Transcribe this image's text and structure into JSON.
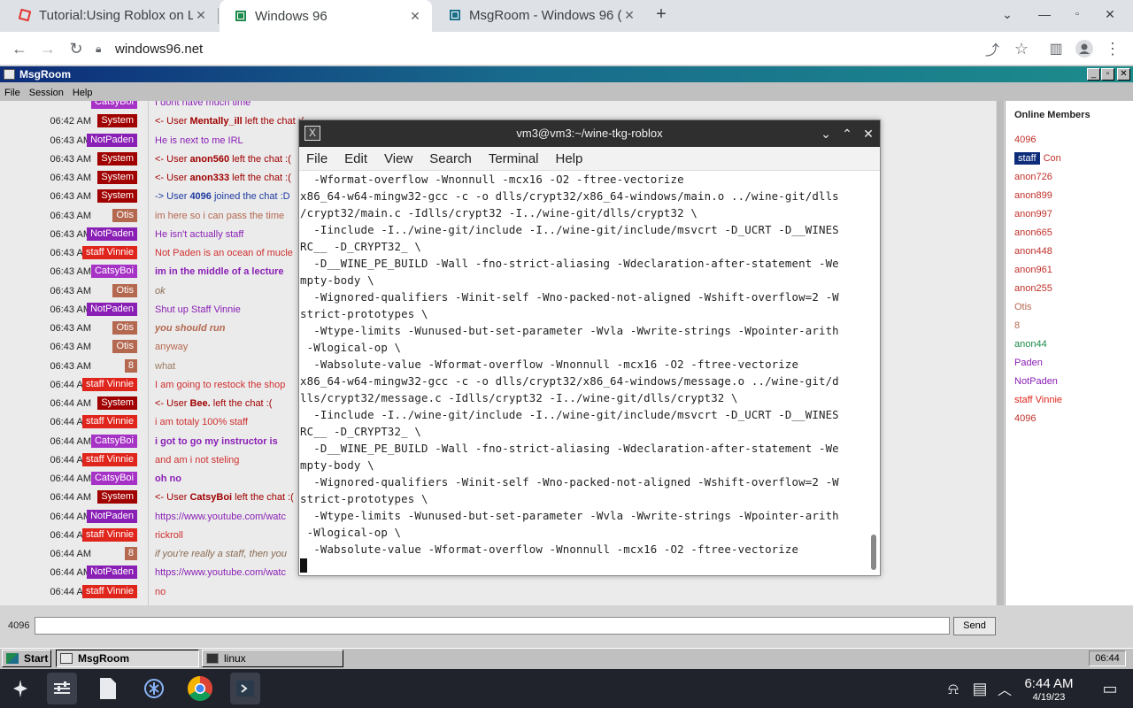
{
  "browser": {
    "tabs": [
      {
        "title": "Tutorial:Using Roblox on L",
        "icon": "roblox-icon",
        "active": false
      },
      {
        "title": "Windows 96",
        "icon": "windows96-icon",
        "active": true
      },
      {
        "title": "MsgRoom - Windows 96 (",
        "icon": "windows96-icon",
        "active": false
      }
    ],
    "new_tab": "+",
    "url": "windows96.net"
  },
  "msgroom": {
    "title": "MsgRoom",
    "menu": [
      "File",
      "Session",
      "Help"
    ],
    "messages": [
      {
        "time": "",
        "user": "CatsyBoi",
        "cls": "catsy",
        "text": "I dont have much time",
        "style": ""
      },
      {
        "time": "06:42 AM",
        "user": "System",
        "cls": "system",
        "text": "<- User Mentally_ill left the chat :(",
        "style": "system-left",
        "actor": "Mentally_ill"
      },
      {
        "time": "06:43 AM",
        "user": "NotPaden",
        "cls": "notpaden",
        "text": "He is next to me IRL",
        "style": ""
      },
      {
        "time": "06:43 AM",
        "user": "System",
        "cls": "system",
        "text": "<- User anon560 left the chat :(",
        "style": "system-left",
        "actor": "anon560"
      },
      {
        "time": "06:43 AM",
        "user": "System",
        "cls": "system",
        "text": "<- User anon333 left the chat :(",
        "style": "system-left",
        "actor": "anon333"
      },
      {
        "time": "06:43 AM",
        "user": "System",
        "cls": "system",
        "text": "-> User 4096 joined the chat :D",
        "style": "system-join",
        "actor": "4096"
      },
      {
        "time": "06:43 AM",
        "user": "Otis",
        "cls": "otis",
        "text": "im here so i can pass the time",
        "style": ""
      },
      {
        "time": "06:43 AM",
        "user": "NotPaden",
        "cls": "notpaden",
        "text": "He isn't actually staff",
        "style": ""
      },
      {
        "time": "06:43 AM",
        "user": "staff Vinnie",
        "cls": "vinnie",
        "text": "Not Paden is an ocean of mucle",
        "style": ""
      },
      {
        "time": "06:43 AM",
        "user": "CatsyBoi",
        "cls": "catsy",
        "text": "im in the middle of a lecture",
        "style": "bold"
      },
      {
        "time": "06:43 AM",
        "user": "Otis",
        "cls": "otis",
        "text": "ok",
        "style": "italic"
      },
      {
        "time": "06:43 AM",
        "user": "NotPaden",
        "cls": "notpaden",
        "text": "Shut up Staff Vinnie",
        "style": ""
      },
      {
        "time": "06:43 AM",
        "user": "Otis",
        "cls": "otis",
        "text": "you should run",
        "style": "bolditalic"
      },
      {
        "time": "06:43 AM",
        "user": "Otis",
        "cls": "otis",
        "text": "anyway",
        "style": ""
      },
      {
        "time": "06:43 AM",
        "user": "8",
        "cls": "eight",
        "text": "what",
        "style": ""
      },
      {
        "time": "06:44 AM",
        "user": "staff Vinnie",
        "cls": "vinnie",
        "text": "I am going to restock the shop",
        "style": ""
      },
      {
        "time": "06:44 AM",
        "user": "System",
        "cls": "system",
        "text": "<- User Bee. left the chat :(",
        "style": "system-left",
        "actor": "Bee."
      },
      {
        "time": "06:44 AM",
        "user": "staff Vinnie",
        "cls": "vinnie",
        "text": "i am totaly 100% staff",
        "style": ""
      },
      {
        "time": "06:44 AM",
        "user": "CatsyBoi",
        "cls": "catsy",
        "text": "i got to go my instructor is",
        "style": "bold"
      },
      {
        "time": "06:44 AM",
        "user": "staff Vinnie",
        "cls": "vinnie",
        "text": "and am i not steling",
        "style": ""
      },
      {
        "time": "06:44 AM",
        "user": "CatsyBoi",
        "cls": "catsy",
        "text": "oh no",
        "style": "bold"
      },
      {
        "time": "06:44 AM",
        "user": "System",
        "cls": "system",
        "text": "<- User CatsyBoi left the chat :(",
        "style": "system-left",
        "actor": "CatsyBoi"
      },
      {
        "time": "06:44 AM",
        "user": "NotPaden",
        "cls": "notpaden",
        "text": "https://www.youtube.com/watc",
        "style": ""
      },
      {
        "time": "06:44 AM",
        "user": "staff Vinnie",
        "cls": "vinnie",
        "text": "rickroll",
        "style": ""
      },
      {
        "time": "06:44 AM",
        "user": "8",
        "cls": "eight",
        "text": "if you're really a staff, then you",
        "style": "italic"
      },
      {
        "time": "06:44 AM",
        "user": "NotPaden",
        "cls": "notpaden",
        "text": "https://www.youtube.com/watc",
        "style": ""
      },
      {
        "time": "06:44 AM",
        "user": "staff Vinnie",
        "cls": "vinnie",
        "text": "no",
        "style": ""
      }
    ],
    "members_title": "Online Members",
    "members": [
      {
        "name": "4096",
        "color": "#c0302a"
      },
      {
        "name": "staff",
        "tag": true,
        "extra": "Con",
        "color": "#c0302a"
      },
      {
        "name": "anon726",
        "color": "#c0302a"
      },
      {
        "name": "anon899",
        "color": "#c0302a"
      },
      {
        "name": "anon997",
        "color": "#c0302a"
      },
      {
        "name": "anon665",
        "color": "#c0302a"
      },
      {
        "name": "anon448",
        "color": "#c0302a"
      },
      {
        "name": "anon961",
        "color": "#c0302a"
      },
      {
        "name": "anon255",
        "color": "#c0302a"
      },
      {
        "name": "Otis",
        "color": "#b46850"
      },
      {
        "name": "8",
        "color": "#b46850"
      },
      {
        "name": "anon44",
        "color": "#1b8a4a"
      },
      {
        "name": "Paden",
        "color": "#8a1fb5"
      },
      {
        "name": "NotPaden",
        "color": "#8a1fb5"
      },
      {
        "name": "staff Vinnie",
        "color": "#e0251c"
      },
      {
        "name": "4096",
        "color": "#c0302a"
      }
    ],
    "nick": "4096",
    "input_value": "",
    "send_label": "Send"
  },
  "w96taskbar": {
    "start": "Start",
    "tasks": [
      "MsgRoom",
      "linux"
    ],
    "clock": "06:44"
  },
  "terminal": {
    "title": "vm3@vm3:~/wine-tkg-roblox",
    "menu": [
      "File",
      "Edit",
      "View",
      "Search",
      "Terminal",
      "Help"
    ],
    "lines": [
      "  -Wformat-overflow -Wnonnull -mcx16 -O2 -ftree-vectorize",
      "x86_64-w64-mingw32-gcc -c -o dlls/crypt32/x86_64-windows/main.o ../wine-git/dlls",
      "/crypt32/main.c -Idlls/crypt32 -I../wine-git/dlls/crypt32 \\",
      "  -Iinclude -I../wine-git/include -I../wine-git/include/msvcrt -D_UCRT -D__WINES",
      "RC__ -D_CRYPT32_ \\",
      "  -D__WINE_PE_BUILD -Wall -fno-strict-aliasing -Wdeclaration-after-statement -We",
      "mpty-body \\",
      "  -Wignored-qualifiers -Winit-self -Wno-packed-not-aligned -Wshift-overflow=2 -W",
      "strict-prototypes \\",
      "  -Wtype-limits -Wunused-but-set-parameter -Wvla -Wwrite-strings -Wpointer-arith",
      " -Wlogical-op \\",
      "  -Wabsolute-value -Wformat-overflow -Wnonnull -mcx16 -O2 -ftree-vectorize",
      "x86_64-w64-mingw32-gcc -c -o dlls/crypt32/x86_64-windows/message.o ../wine-git/d",
      "lls/crypt32/message.c -Idlls/crypt32 -I../wine-git/dlls/crypt32 \\",
      "  -Iinclude -I../wine-git/include -I../wine-git/include/msvcrt -D_UCRT -D__WINES",
      "RC__ -D_CRYPT32_ \\",
      "  -D__WINE_PE_BUILD -Wall -fno-strict-aliasing -Wdeclaration-after-statement -We",
      "mpty-body \\",
      "  -Wignored-qualifiers -Winit-self -Wno-packed-not-aligned -Wshift-overflow=2 -W",
      "strict-prototypes \\",
      "  -Wtype-limits -Wunused-but-set-parameter -Wvla -Wwrite-strings -Wpointer-arith",
      " -Wlogical-op \\",
      "  -Wabsolute-value -Wformat-overflow -Wnonnull -mcx16 -O2 -ftree-vectorize"
    ]
  },
  "shelf": {
    "time": "6:44 AM",
    "date": "4/19/23"
  }
}
